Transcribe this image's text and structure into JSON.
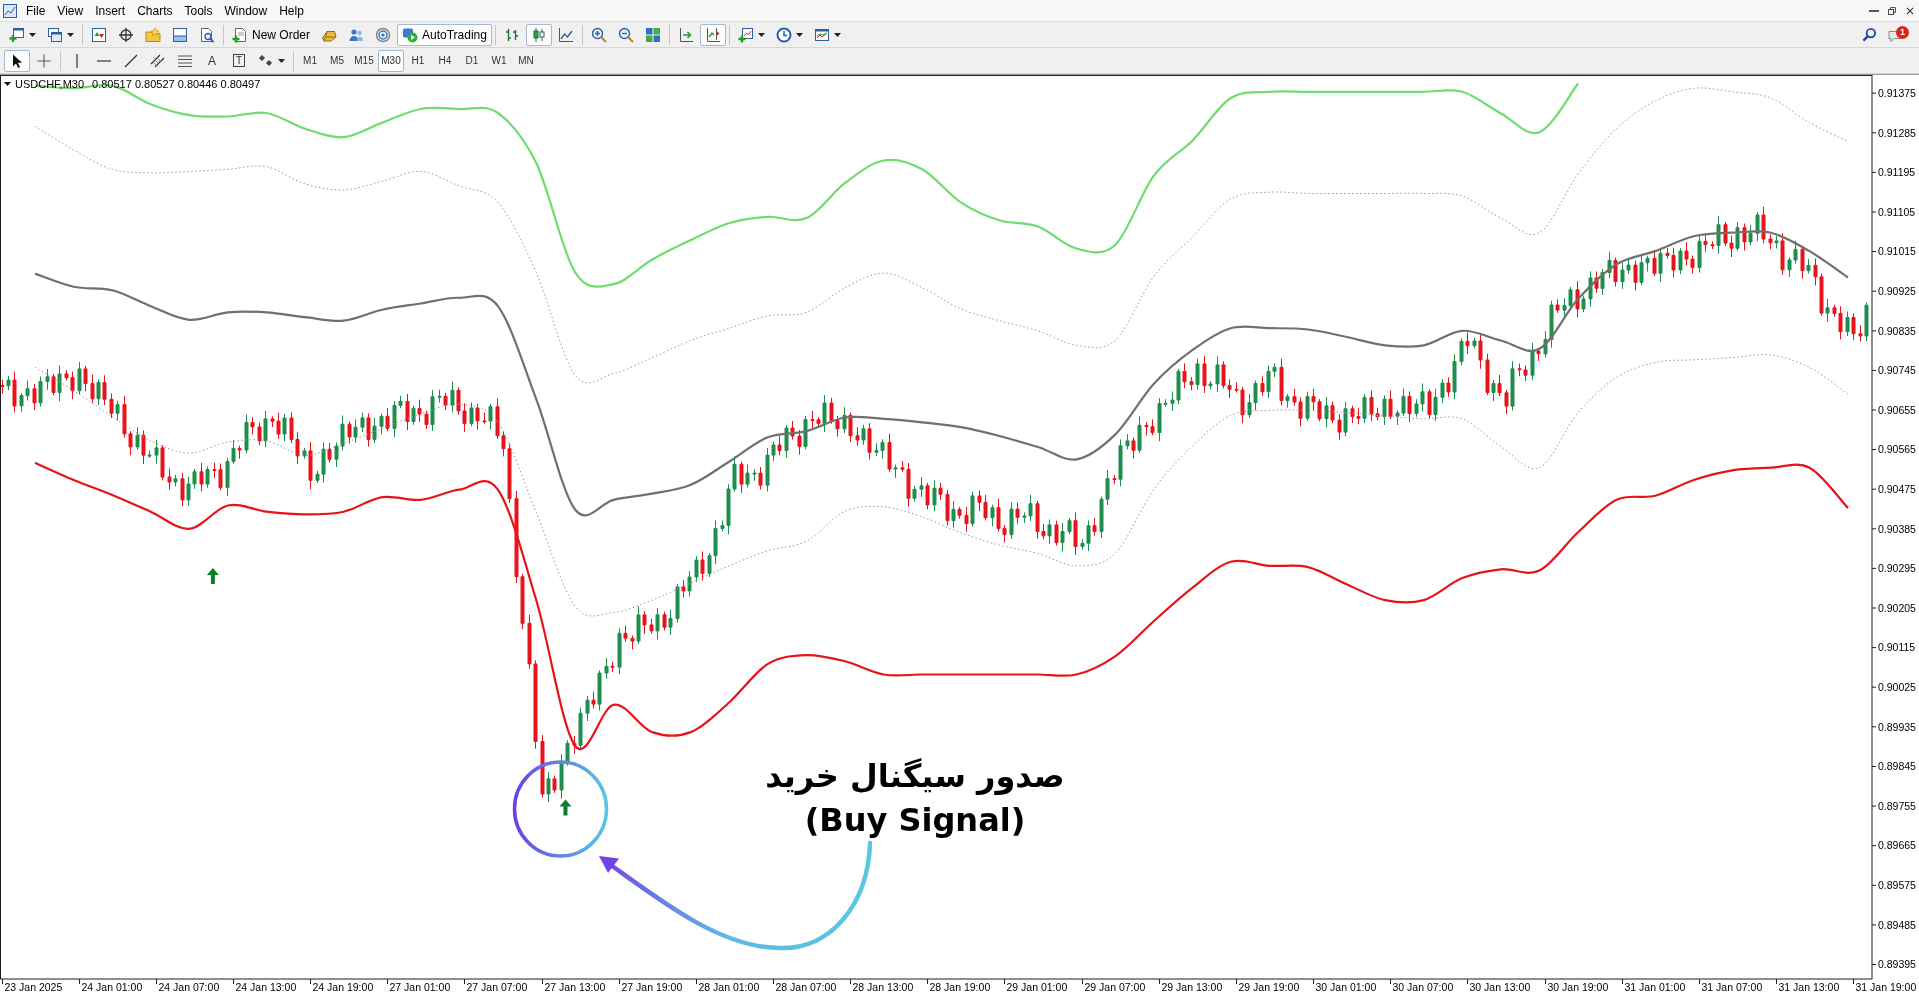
{
  "menu": {
    "items": [
      "File",
      "View",
      "Insert",
      "Charts",
      "Tools",
      "Window",
      "Help"
    ]
  },
  "toolbar_main": [
    [
      {
        "kind": "icon",
        "dropdown": true,
        "selected": false
      },
      {
        "kind": "icon",
        "dropdown": true,
        "selected": false
      }
    ],
    [
      {
        "kind": "icon",
        "dropdown": false,
        "selected": false
      },
      {
        "kind": "icon",
        "dropdown": false,
        "selected": false
      },
      {
        "kind": "icon",
        "dropdown": false,
        "selected": false
      },
      {
        "kind": "icon",
        "dropdown": false,
        "selected": false
      },
      {
        "kind": "icon",
        "dropdown": false,
        "selected": false
      }
    ],
    [
      {
        "kind": "button",
        "label": "New Order",
        "dropdown": false,
        "selected": false
      },
      {
        "kind": "icon",
        "dropdown": false,
        "selected": false
      },
      {
        "kind": "icon",
        "dropdown": false,
        "selected": false
      },
      {
        "kind": "icon",
        "dropdown": false,
        "selected": false
      },
      {
        "kind": "button",
        "label": "AutoTrading",
        "dropdown": false,
        "selected": true
      }
    ],
    [
      {
        "kind": "icon",
        "dropdown": false,
        "selected": false
      },
      {
        "kind": "icon",
        "dropdown": false,
        "selected": true
      },
      {
        "kind": "icon",
        "dropdown": false,
        "selected": false
      }
    ],
    [
      {
        "kind": "icon",
        "dropdown": false,
        "selected": false
      },
      {
        "kind": "icon",
        "dropdown": false,
        "selected": false
      },
      {
        "kind": "icon",
        "dropdown": false,
        "selected": false
      }
    ],
    [
      {
        "kind": "icon",
        "dropdown": false,
        "selected": false
      },
      {
        "kind": "icon",
        "dropdown": false,
        "selected": true
      }
    ],
    [
      {
        "kind": "icon",
        "dropdown": true,
        "selected": false
      },
      {
        "kind": "icon",
        "dropdown": true,
        "selected": false
      },
      {
        "kind": "icon",
        "dropdown": true,
        "selected": false
      }
    ]
  ],
  "toolbar_drawing": [
    [
      {
        "kind": "icon",
        "dropdown": false,
        "selected": true
      },
      {
        "kind": "icon",
        "dropdown": false,
        "selected": false
      }
    ],
    [
      {
        "kind": "icon",
        "dropdown": false,
        "selected": false
      },
      {
        "kind": "icon",
        "dropdown": false,
        "selected": false
      },
      {
        "kind": "icon",
        "dropdown": false,
        "selected": false
      },
      {
        "kind": "icon",
        "dropdown": false,
        "selected": false
      },
      {
        "kind": "icon",
        "dropdown": false,
        "selected": false
      },
      {
        "kind": "letter",
        "text": "A",
        "dropdown": false,
        "selected": false
      },
      {
        "kind": "boxed",
        "text": "T",
        "dropdown": false,
        "selected": false
      },
      {
        "kind": "icon",
        "dropdown": true,
        "selected": false
      }
    ],
    [
      {
        "kind": "timeframe",
        "label": "M1",
        "selected": false
      },
      {
        "kind": "timeframe",
        "label": "M5",
        "selected": false
      },
      {
        "kind": "timeframe",
        "label": "M15",
        "selected": false
      },
      {
        "kind": "timeframe",
        "label": "M30",
        "selected": true
      },
      {
        "kind": "timeframe",
        "label": "H1",
        "selected": false
      },
      {
        "kind": "timeframe",
        "label": "H4",
        "selected": false
      },
      {
        "kind": "timeframe",
        "label": "D1",
        "selected": false
      },
      {
        "kind": "timeframe",
        "label": "W1",
        "selected": false
      },
      {
        "kind": "timeframe",
        "label": "MN",
        "selected": false
      }
    ]
  ],
  "notifications": {
    "count": "1"
  },
  "chart": {
    "symbol": "USDCHF,M30",
    "quote": "0.80517 0.80527 0.80446 0.80497",
    "chart_data": {
      "type": "line",
      "categories": [
        "23 Jan 2025",
        null,
        "24 Jan 01:00",
        null,
        "24 Jan 07:00",
        null,
        "24 Jan 13:00",
        null,
        "24 Jan 19:00",
        null,
        "27 Jan 01:00",
        null,
        "27 Jan 07:00",
        null,
        "27 Jan 13:00",
        null,
        "27 Jan 19:00",
        null,
        "28 Jan 01:00",
        null,
        "28 Jan 07:00",
        null,
        "28 Jan 13:00",
        null,
        "28 Jan 19:00",
        null,
        "29 Jan 01:00",
        null,
        "29 Jan 07:00",
        null,
        "29 Jan 13:00",
        null,
        "29 Jan 19:00",
        null,
        "30 Jan 01:00",
        null,
        "30 Jan 07:00",
        null,
        "30 Jan 13:00",
        null,
        "30 Jan 19:00",
        null,
        "31 Jan 01:00",
        null,
        "31 Jan 07:00",
        null,
        "31 Jan 13:00",
        null,
        "31 Jan 19:00"
      ],
      "ylim": [
        0.89362,
        0.91414
      ],
      "yticks": [
        0.91375,
        0.91285,
        0.91195,
        0.91105,
        0.91015,
        0.90925,
        0.90835,
        0.90745,
        0.90655,
        0.90565,
        0.90475,
        0.90385,
        0.90295,
        0.90205,
        0.90115,
        0.90025,
        0.89935,
        0.89845,
        0.89755,
        0.89665,
        0.89575,
        0.89485,
        0.89395
      ],
      "series": [
        {
          "color": "#6fdc6f",
          "values": [
            0.91392,
            0.91386,
            0.91392,
            0.9135,
            0.91325,
            0.91322,
            0.9133,
            0.91294,
            0.91275,
            0.91308,
            0.91339,
            0.91339,
            0.9133,
            0.91215,
            0.90968,
            0.90941,
            0.90997,
            0.91041,
            0.9108,
            0.91094,
            0.91091,
            0.91171,
            0.91222,
            0.91202,
            0.91127,
            0.91086,
            0.91072,
            0.91022,
            0.9103,
            0.91187,
            0.91267,
            0.91364,
            0.91378,
            0.91378,
            0.91378,
            0.91378,
            0.91378,
            0.91378,
            0.91329,
            0.91286,
            0.91397,
            null,
            null,
            null,
            null,
            null,
            null,
            null,
            null
          ]
        },
        {
          "color": "#9a9a9a",
          "line_style": "dotted",
          "values": [
            0.913,
            0.91246,
            0.91202,
            0.91194,
            0.91197,
            0.91202,
            0.91208,
            0.91169,
            0.91155,
            0.91175,
            0.91197,
            0.91164,
            0.91127,
            0.90966,
            0.90734,
            0.90738,
            0.90774,
            0.90813,
            0.90841,
            0.90869,
            0.90877,
            0.90933,
            0.90966,
            0.90933,
            0.90885,
            0.90858,
            0.90835,
            0.90802,
            0.90813,
            0.90958,
            0.91048,
            0.91135,
            0.9115,
            0.91147,
            0.91147,
            0.91147,
            0.91147,
            0.91141,
            0.91091,
            0.91058,
            0.91191,
            0.91295,
            0.91357,
            0.91386,
            0.91378,
            0.91364,
            0.91308,
            0.91265,
            null
          ]
        },
        {
          "color": "#707070",
          "values": [
            0.90965,
            0.90935,
            0.90927,
            0.90891,
            0.9086,
            0.90877,
            0.90877,
            0.90866,
            0.90858,
            0.90883,
            0.90897,
            0.9091,
            0.90891,
            0.90678,
            0.90429,
            0.90451,
            0.90465,
            0.90485,
            0.90538,
            0.90593,
            0.90607,
            0.90638,
            0.90635,
            0.90627,
            0.90616,
            0.90596,
            0.90571,
            0.90543,
            0.90599,
            0.90714,
            0.90791,
            0.90841,
            0.90841,
            0.90838,
            0.90821,
            0.90802,
            0.90802,
            0.90835,
            0.90813,
            0.90794,
            0.90907,
            0.90986,
            0.91016,
            0.9105,
            0.91058,
            0.91058,
            0.91016,
            0.90956,
            null
          ]
        },
        {
          "color": "#9a9a9a",
          "line_style": "dotted",
          "values": [
            0.90752,
            0.90699,
            0.9064,
            0.90585,
            0.90557,
            0.90582,
            0.90585,
            0.90552,
            0.90579,
            0.90613,
            0.90646,
            0.90668,
            0.90627,
            0.90421,
            0.90209,
            0.90195,
            0.90223,
            0.90262,
            0.90301,
            0.90335,
            0.90357,
            0.90425,
            0.90435,
            0.90412,
            0.90376,
            0.90348,
            0.90329,
            0.90301,
            0.90329,
            0.90474,
            0.90573,
            0.90643,
            0.90654,
            0.90654,
            0.90649,
            0.90641,
            0.90635,
            0.90635,
            0.90572,
            0.90524,
            0.90649,
            0.90729,
            0.90763,
            0.90769,
            0.90774,
            0.9078,
            0.90752,
            0.90691,
            null
          ]
        },
        {
          "color": "#e5141b",
          "values": [
            0.90535,
            0.90496,
            0.90462,
            0.90424,
            0.90385,
            0.90438,
            0.90424,
            0.90418,
            0.90424,
            0.90457,
            0.90451,
            0.90474,
            0.90474,
            0.90221,
            0.89892,
            0.89985,
            0.89923,
            0.89923,
            0.89991,
            0.90078,
            0.90098,
            0.90084,
            0.90054,
            0.90054,
            0.90054,
            0.90054,
            0.90054,
            0.90054,
            0.90095,
            0.90175,
            0.90251,
            0.9031,
            0.90301,
            0.90298,
            0.90259,
            0.90223,
            0.90223,
            0.90273,
            0.90293,
            0.9029,
            0.90377,
            0.90451,
            0.9046,
            0.90496,
            0.90518,
            0.90524,
            0.90524,
            0.90432,
            null
          ]
        }
      ]
    }
  },
  "callout": {
    "title": "صدور سیگنال خرید",
    "subtitle": "(Buy Signal)"
  }
}
